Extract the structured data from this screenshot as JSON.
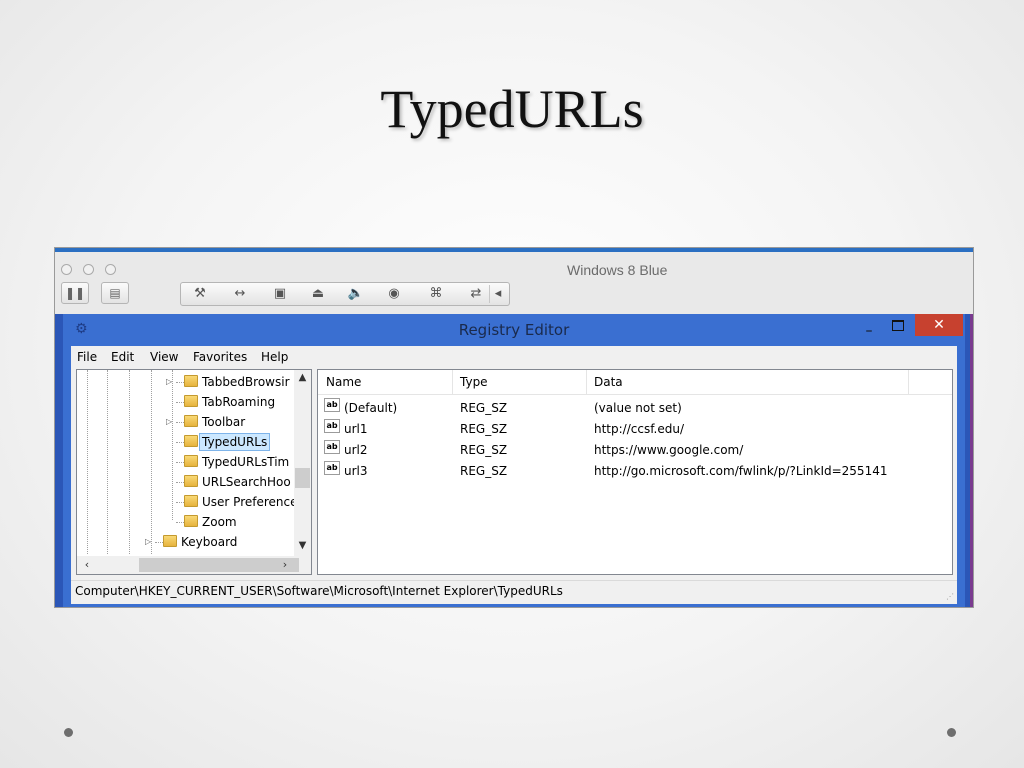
{
  "slide": {
    "title": "TypedURLs"
  },
  "vm": {
    "window_title": "Windows 8 Blue",
    "toolbar_icons": [
      "pause-icon",
      "snapshot-icon",
      "settings-wrench-icon",
      "resize-arrows-icon",
      "disk-icon",
      "cd-drive-icon",
      "volume-icon",
      "camera-icon",
      "usb-icon",
      "network-icon",
      "collapse-arrow-icon"
    ]
  },
  "regedit": {
    "title": "Registry Editor",
    "close_glyph": "✕",
    "minimize_glyph": "–",
    "menu": [
      "File",
      "Edit",
      "View",
      "Favorites",
      "Help"
    ],
    "tree": [
      {
        "label": "TabbedBrowsir",
        "expander": "▷",
        "selected": false
      },
      {
        "label": "TabRoaming",
        "expander": "",
        "selected": false
      },
      {
        "label": "Toolbar",
        "expander": "▷",
        "selected": false
      },
      {
        "label": "TypedURLs",
        "expander": "",
        "selected": true
      },
      {
        "label": "TypedURLsTim",
        "expander": "",
        "selected": false
      },
      {
        "label": "URLSearchHoo",
        "expander": "",
        "selected": false
      },
      {
        "label": "User Preference",
        "expander": "",
        "selected": false
      },
      {
        "label": "Zoom",
        "expander": "",
        "selected": false
      },
      {
        "label": "Keyboard",
        "expander": "▷",
        "selected": false
      }
    ],
    "columns": [
      "Name",
      "Type",
      "Data"
    ],
    "values": [
      {
        "name": "(Default)",
        "type": "REG_SZ",
        "data": "(value not set)",
        "icon": "ab"
      },
      {
        "name": "url1",
        "type": "REG_SZ",
        "data": "http://ccsf.edu/",
        "icon": "ab"
      },
      {
        "name": "url2",
        "type": "REG_SZ",
        "data": "https://www.google.com/",
        "icon": "ab"
      },
      {
        "name": "url3",
        "type": "REG_SZ",
        "data": "http://go.microsoft.com/fwlink/p/?LinkId=255141",
        "icon": "ab"
      }
    ],
    "status_path": "Computer\\HKEY_CURRENT_USER\\Software\\Microsoft\\Internet Explorer\\TypedURLs"
  }
}
